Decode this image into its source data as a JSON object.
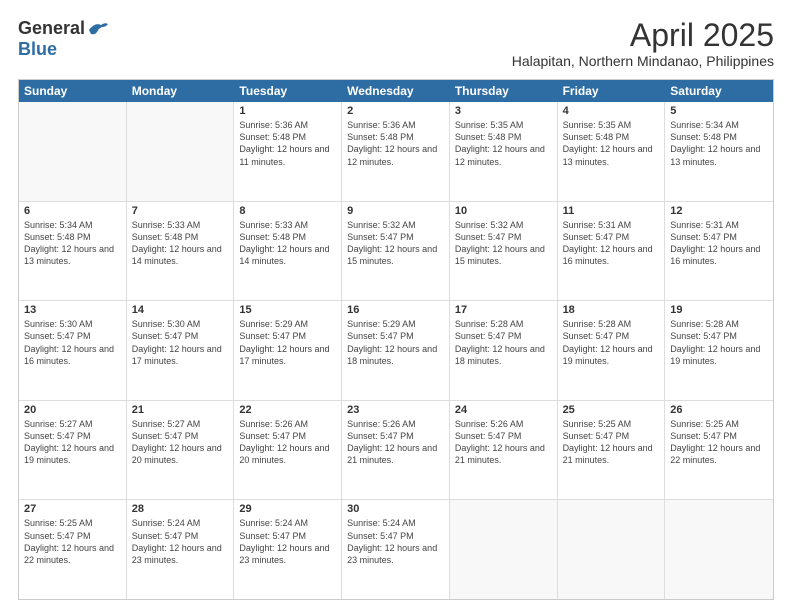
{
  "header": {
    "logo_general": "General",
    "logo_blue": "Blue",
    "main_title": "April 2025",
    "subtitle": "Halapitan, Northern Mindanao, Philippines"
  },
  "days_of_week": [
    "Sunday",
    "Monday",
    "Tuesday",
    "Wednesday",
    "Thursday",
    "Friday",
    "Saturday"
  ],
  "weeks": [
    [
      {
        "day": "",
        "info": ""
      },
      {
        "day": "",
        "info": ""
      },
      {
        "day": "1",
        "info": "Sunrise: 5:36 AM\nSunset: 5:48 PM\nDaylight: 12 hours and 11 minutes."
      },
      {
        "day": "2",
        "info": "Sunrise: 5:36 AM\nSunset: 5:48 PM\nDaylight: 12 hours and 12 minutes."
      },
      {
        "day": "3",
        "info": "Sunrise: 5:35 AM\nSunset: 5:48 PM\nDaylight: 12 hours and 12 minutes."
      },
      {
        "day": "4",
        "info": "Sunrise: 5:35 AM\nSunset: 5:48 PM\nDaylight: 12 hours and 13 minutes."
      },
      {
        "day": "5",
        "info": "Sunrise: 5:34 AM\nSunset: 5:48 PM\nDaylight: 12 hours and 13 minutes."
      }
    ],
    [
      {
        "day": "6",
        "info": "Sunrise: 5:34 AM\nSunset: 5:48 PM\nDaylight: 12 hours and 13 minutes."
      },
      {
        "day": "7",
        "info": "Sunrise: 5:33 AM\nSunset: 5:48 PM\nDaylight: 12 hours and 14 minutes."
      },
      {
        "day": "8",
        "info": "Sunrise: 5:33 AM\nSunset: 5:48 PM\nDaylight: 12 hours and 14 minutes."
      },
      {
        "day": "9",
        "info": "Sunrise: 5:32 AM\nSunset: 5:47 PM\nDaylight: 12 hours and 15 minutes."
      },
      {
        "day": "10",
        "info": "Sunrise: 5:32 AM\nSunset: 5:47 PM\nDaylight: 12 hours and 15 minutes."
      },
      {
        "day": "11",
        "info": "Sunrise: 5:31 AM\nSunset: 5:47 PM\nDaylight: 12 hours and 16 minutes."
      },
      {
        "day": "12",
        "info": "Sunrise: 5:31 AM\nSunset: 5:47 PM\nDaylight: 12 hours and 16 minutes."
      }
    ],
    [
      {
        "day": "13",
        "info": "Sunrise: 5:30 AM\nSunset: 5:47 PM\nDaylight: 12 hours and 16 minutes."
      },
      {
        "day": "14",
        "info": "Sunrise: 5:30 AM\nSunset: 5:47 PM\nDaylight: 12 hours and 17 minutes."
      },
      {
        "day": "15",
        "info": "Sunrise: 5:29 AM\nSunset: 5:47 PM\nDaylight: 12 hours and 17 minutes."
      },
      {
        "day": "16",
        "info": "Sunrise: 5:29 AM\nSunset: 5:47 PM\nDaylight: 12 hours and 18 minutes."
      },
      {
        "day": "17",
        "info": "Sunrise: 5:28 AM\nSunset: 5:47 PM\nDaylight: 12 hours and 18 minutes."
      },
      {
        "day": "18",
        "info": "Sunrise: 5:28 AM\nSunset: 5:47 PM\nDaylight: 12 hours and 19 minutes."
      },
      {
        "day": "19",
        "info": "Sunrise: 5:28 AM\nSunset: 5:47 PM\nDaylight: 12 hours and 19 minutes."
      }
    ],
    [
      {
        "day": "20",
        "info": "Sunrise: 5:27 AM\nSunset: 5:47 PM\nDaylight: 12 hours and 19 minutes."
      },
      {
        "day": "21",
        "info": "Sunrise: 5:27 AM\nSunset: 5:47 PM\nDaylight: 12 hours and 20 minutes."
      },
      {
        "day": "22",
        "info": "Sunrise: 5:26 AM\nSunset: 5:47 PM\nDaylight: 12 hours and 20 minutes."
      },
      {
        "day": "23",
        "info": "Sunrise: 5:26 AM\nSunset: 5:47 PM\nDaylight: 12 hours and 21 minutes."
      },
      {
        "day": "24",
        "info": "Sunrise: 5:26 AM\nSunset: 5:47 PM\nDaylight: 12 hours and 21 minutes."
      },
      {
        "day": "25",
        "info": "Sunrise: 5:25 AM\nSunset: 5:47 PM\nDaylight: 12 hours and 21 minutes."
      },
      {
        "day": "26",
        "info": "Sunrise: 5:25 AM\nSunset: 5:47 PM\nDaylight: 12 hours and 22 minutes."
      }
    ],
    [
      {
        "day": "27",
        "info": "Sunrise: 5:25 AM\nSunset: 5:47 PM\nDaylight: 12 hours and 22 minutes."
      },
      {
        "day": "28",
        "info": "Sunrise: 5:24 AM\nSunset: 5:47 PM\nDaylight: 12 hours and 23 minutes."
      },
      {
        "day": "29",
        "info": "Sunrise: 5:24 AM\nSunset: 5:47 PM\nDaylight: 12 hours and 23 minutes."
      },
      {
        "day": "30",
        "info": "Sunrise: 5:24 AM\nSunset: 5:47 PM\nDaylight: 12 hours and 23 minutes."
      },
      {
        "day": "",
        "info": ""
      },
      {
        "day": "",
        "info": ""
      },
      {
        "day": "",
        "info": ""
      }
    ]
  ]
}
